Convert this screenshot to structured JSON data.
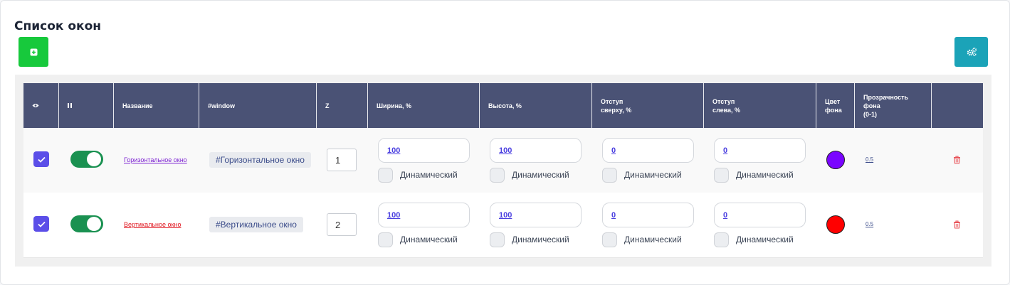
{
  "page": {
    "title": "Список окон"
  },
  "toolbar": {
    "add_icon": "plus-square-icon",
    "settings_icon": "gears-icon"
  },
  "columns": [
    {
      "label": "",
      "icon": "eye-icon"
    },
    {
      "label": "",
      "icon": "pause-icon"
    },
    {
      "label": "Название"
    },
    {
      "label": "#window"
    },
    {
      "label": "Z"
    },
    {
      "label": "Ширина, %"
    },
    {
      "label": "Высота, %"
    },
    {
      "label": "Отступ\nсверху, %"
    },
    {
      "label": "Отступ\nслева, %"
    },
    {
      "label": "Цвет\nфона"
    },
    {
      "label": "Прозрачность\nфона\n(0-1)"
    },
    {
      "label": ""
    }
  ],
  "rows": [
    {
      "visible": true,
      "active": true,
      "name": "Горизонтальное окно",
      "name_color": "#7a1fd1",
      "window_id": "#Горизонтальное окно",
      "z": "1",
      "width": "100",
      "height": "100",
      "top": "0",
      "left": "0",
      "dynamic_label": "Динамический",
      "bg_color": "#7a05ff",
      "opacity": "0.5"
    },
    {
      "visible": true,
      "active": true,
      "name": "Вертикальное окно",
      "name_color": "#e0141e",
      "window_id": "#Вертикальное окно",
      "z": "2",
      "width": "100",
      "height": "100",
      "top": "0",
      "left": "0",
      "dynamic_label": "Динамический",
      "bg_color": "#ff0000",
      "opacity": "0.5"
    }
  ],
  "colors": {
    "header_bg": "#4a5275",
    "add_button": "#17c93c",
    "settings_button": "#1ba3b8",
    "checkbox": "#5b4ee8",
    "toggle": "#1a9151",
    "delete_icon": "#e8545a"
  }
}
